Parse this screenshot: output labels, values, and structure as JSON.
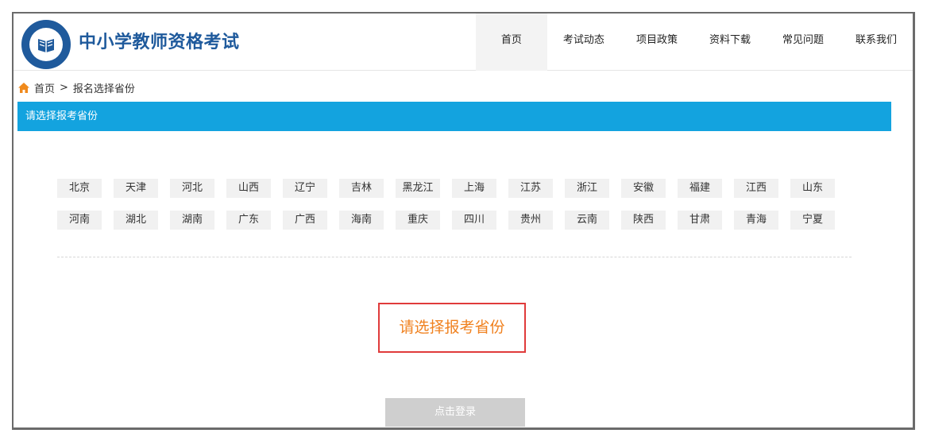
{
  "site": {
    "title": "中小学教师资格考试"
  },
  "nav": [
    {
      "label": "首页",
      "active": true
    },
    {
      "label": "考试动态"
    },
    {
      "label": "项目政策"
    },
    {
      "label": "资料下载"
    },
    {
      "label": "常见问题"
    },
    {
      "label": "联系我们"
    }
  ],
  "breadcrumb": {
    "home": "首页",
    "separator": ">",
    "current": "报名选择省份"
  },
  "section": {
    "title": "请选择报考省份"
  },
  "provinces": [
    "北京",
    "天津",
    "河北",
    "山西",
    "辽宁",
    "吉林",
    "黑龙江",
    "上海",
    "江苏",
    "浙江",
    "安徽",
    "福建",
    "江西",
    "山东",
    "河南",
    "湖北",
    "湖南",
    "广东",
    "广西",
    "海南",
    "重庆",
    "四川",
    "贵州",
    "云南",
    "陕西",
    "甘肃",
    "青海",
    "宁夏"
  ],
  "notice": {
    "text": "请选择报考省份"
  },
  "login_button": {
    "label": "点击登录"
  },
  "colors": {
    "brand": "#1f5a9c",
    "section_bar": "#13a3df",
    "notice_text": "#f0811f",
    "notice_border": "#e03b3b",
    "home_icon": "#f08a1c"
  }
}
